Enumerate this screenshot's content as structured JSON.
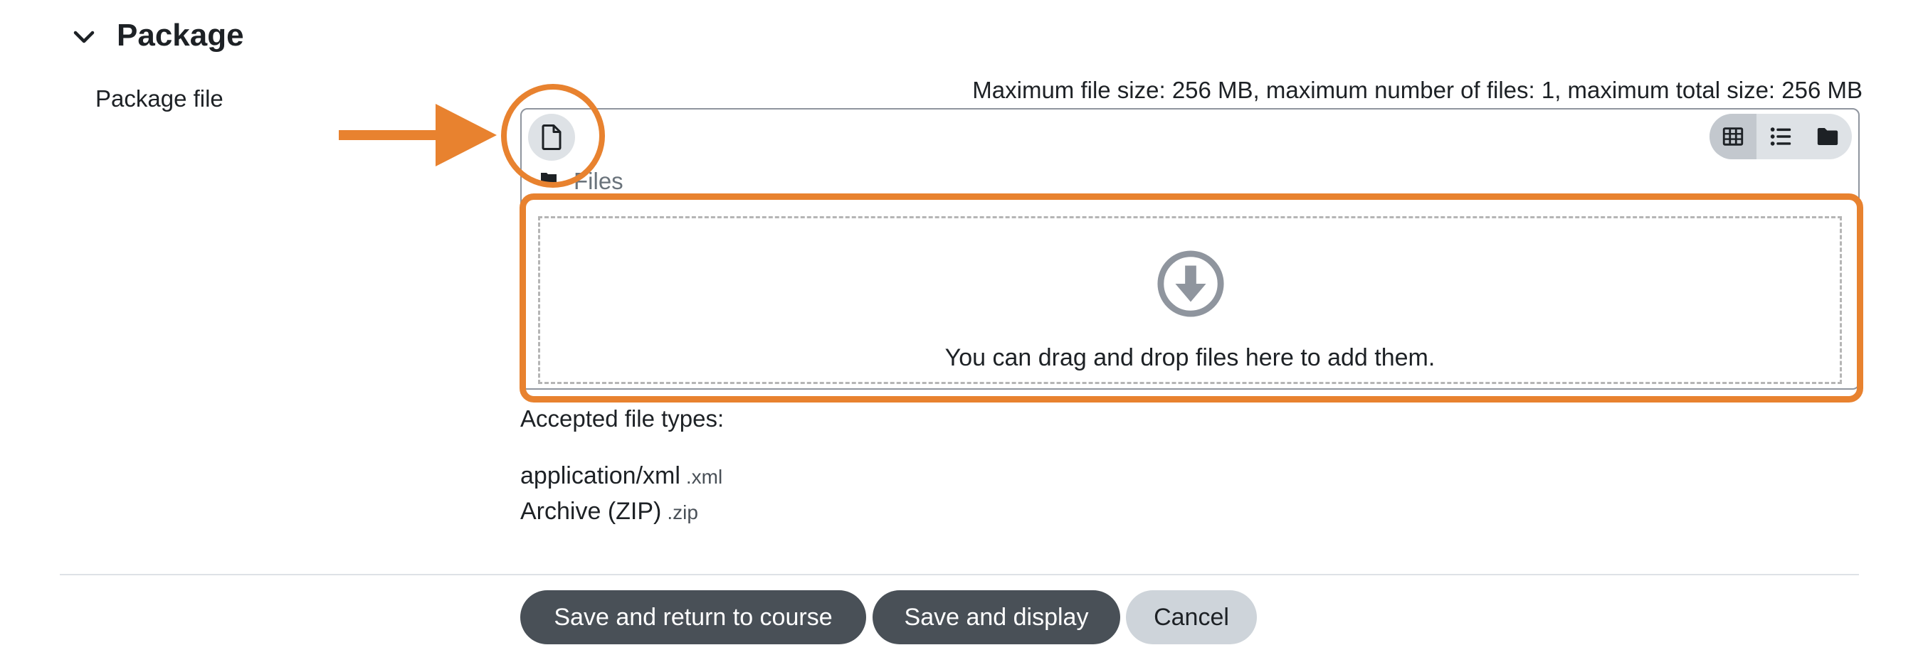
{
  "section": {
    "title": "Package",
    "icon": "chevron-down-icon"
  },
  "field": {
    "label": "Package file",
    "limits_text": "Maximum file size: 256 MB, maximum number of files: 1, maximum total size: 256 MB"
  },
  "filemanager": {
    "add_file_icon": "file-icon",
    "view_icons": [
      "grid-icon",
      "list-icon",
      "folder-icon"
    ],
    "path_label": "Files",
    "dropzone_text": "You can drag and drop files here to add them."
  },
  "accepted": {
    "title": "Accepted file types:",
    "types": [
      {
        "name": "application/xml",
        "ext": ".xml"
      },
      {
        "name": "Archive (ZIP)",
        "ext": ".zip"
      }
    ]
  },
  "buttons": {
    "save_return": "Save and return to course",
    "save_display": "Save and display",
    "cancel": "Cancel"
  },
  "colors": {
    "annotation": "#e8822f",
    "primary_button": "#495057",
    "secondary_button": "#ced4da"
  }
}
